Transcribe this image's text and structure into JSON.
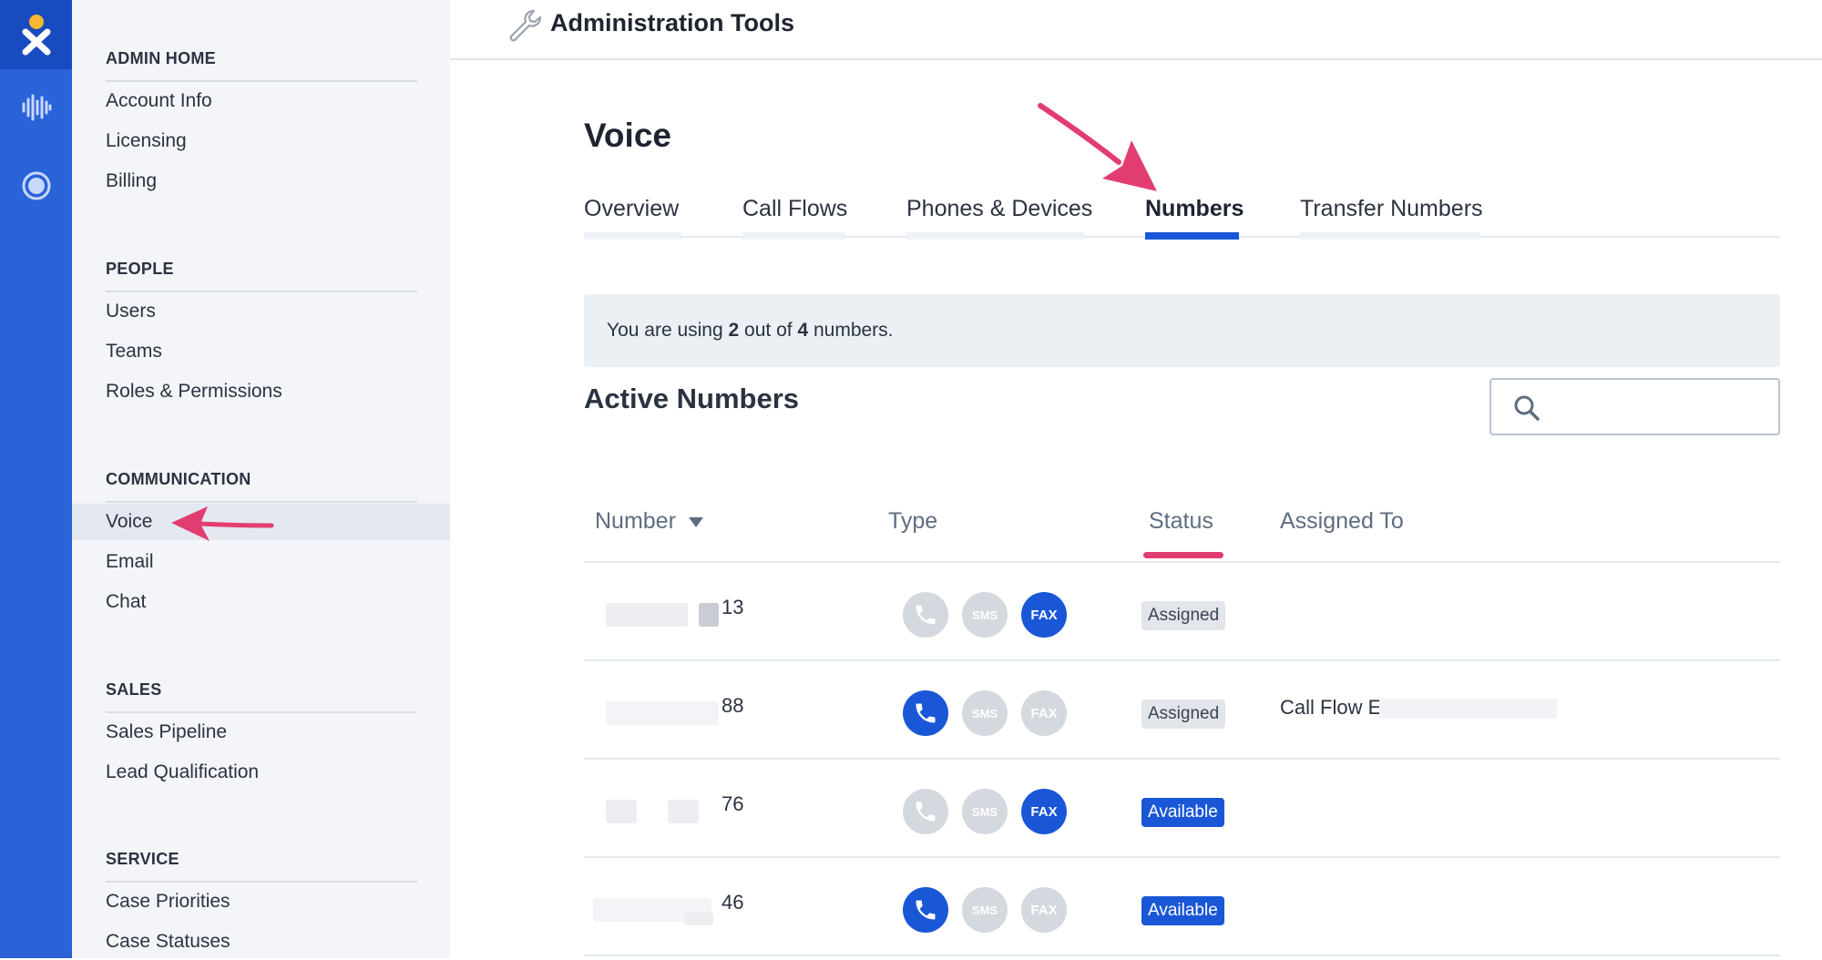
{
  "rail": {
    "logo_icon": "nextiva-x-logo",
    "items": [
      {
        "icon": "voice-waveform-icon"
      },
      {
        "icon": "circle-status-icon"
      }
    ],
    "color": "#2a62d8"
  },
  "sidebar": {
    "sections": [
      {
        "title": "ADMIN HOME",
        "items": [
          "Account Info",
          "Licensing",
          "Billing"
        ]
      },
      {
        "title": "PEOPLE",
        "items": [
          "Users",
          "Teams",
          "Roles & Permissions"
        ]
      },
      {
        "title": "COMMUNICATION",
        "items": [
          "Voice",
          "Email",
          "Chat"
        ],
        "active": "Voice"
      },
      {
        "title": "SALES",
        "items": [
          "Sales Pipeline",
          "Lead Qualification"
        ]
      },
      {
        "title": "SERVICE",
        "items": [
          "Case Priorities",
          "Case Statuses"
        ]
      }
    ]
  },
  "header": {
    "title": "Administration Tools",
    "icon": "wrench-icon"
  },
  "main": {
    "title": "Voice",
    "tabs": [
      {
        "label": "Overview"
      },
      {
        "label": "Call Flows"
      },
      {
        "label": "Phones & Devices"
      },
      {
        "label": "Numbers",
        "active": true
      },
      {
        "label": "Transfer Numbers"
      }
    ],
    "usage": {
      "prefix": "You are using",
      "used": "2",
      "middle": "out of",
      "total": "4",
      "suffix": "numbers."
    },
    "section_title": "Active Numbers",
    "search": {
      "placeholder": "",
      "icon": "search-icon"
    },
    "table": {
      "columns": [
        "Number",
        "Type",
        "Status",
        "Assigned To"
      ],
      "sorted_column": "Number",
      "rows": [
        {
          "number_suffix": "13",
          "voice": false,
          "sms": false,
          "fax": true,
          "status": "Assigned",
          "status_style": "assigned",
          "assigned_to": ""
        },
        {
          "number_suffix": "88",
          "voice": true,
          "sms": false,
          "fax": false,
          "status": "Assigned",
          "status_style": "assigned",
          "assigned_to": "Call Flow E"
        },
        {
          "number_suffix": "76",
          "voice": false,
          "sms": false,
          "fax": true,
          "status": "Available",
          "status_style": "available",
          "assigned_to": ""
        },
        {
          "number_suffix": "46",
          "voice": true,
          "sms": false,
          "fax": false,
          "status": "Available",
          "status_style": "available",
          "assigned_to": ""
        }
      ],
      "type_labels": {
        "sms": "SMS",
        "fax": "FAX"
      }
    }
  },
  "colors": {
    "accent": "#1a57d6",
    "annotation_arrow": "#e23d71"
  }
}
